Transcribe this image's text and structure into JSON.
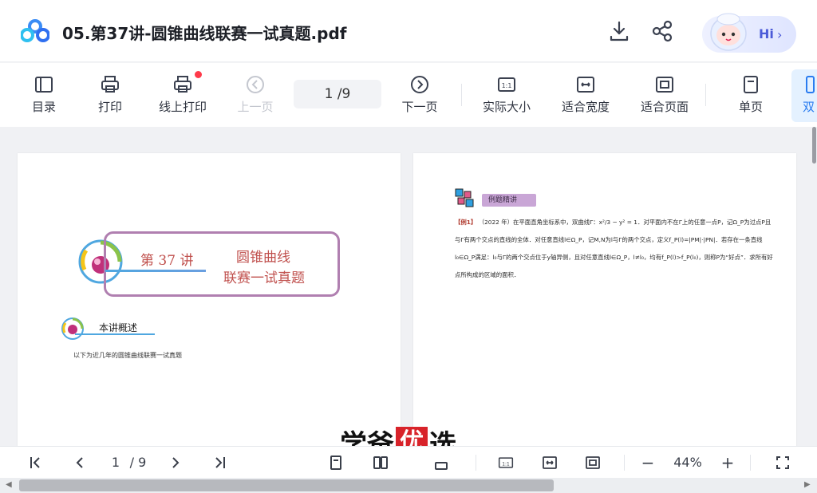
{
  "header": {
    "title": "05.第37讲-圆锥曲线联赛一试真题.pdf",
    "hi_label": "Hi",
    "icons": [
      "download-icon",
      "share-icon"
    ]
  },
  "toolbar": {
    "toc": "目录",
    "print": "打印",
    "online_print": "线上打印",
    "prev_page": "上一页",
    "page_indicator": "1  /9",
    "next_page": "下一页",
    "actual_size": "实际大小",
    "fit_width": "适合宽度",
    "fit_page": "适合页面",
    "single_page": "单页",
    "double_page": "双",
    "accent_color": "#2a7cf0",
    "notify_color": "#ff3a4a"
  },
  "document": {
    "left_page": {
      "chapter_number": "第 37 讲",
      "chapter_title_line1": "圆锥曲线",
      "chapter_title_line2": "联赛一试真题",
      "section_heading": "本讲概述",
      "section_body": "以下为近几年的圆锥曲线联赛一试真题"
    },
    "right_page": {
      "example_tag": "例题精讲",
      "example_label": "【例1】",
      "example_text": "（2022 年）在平面直角坐标系中，双曲线Γ：x²/3 − y² = 1．对平面内不在Γ上的任意一点P，记Ω_P为过点P且与Γ有两个交点的直线的全体．对任意直线l∈Ω_P，记M,N为l与Γ的两个交点，定义f_P(l)=|PM|·|PN|．若存在一条直线l₀∈Ω_P满足：l₀与Γ的两个交点位于y轴异侧，且对任意直线l∈Ω_P，l≠l₀，均有f_P(l)>f_P(l₀)，则称P为“好点”．求所有好点所构成的区域的面积．"
    }
  },
  "bottombar": {
    "page_current": "1",
    "page_total": "/ 9",
    "zoom": "44%",
    "minus": "−",
    "plus": "+"
  },
  "watermark": {
    "part1": "学爸",
    "part2": "优",
    "part3": "选"
  }
}
